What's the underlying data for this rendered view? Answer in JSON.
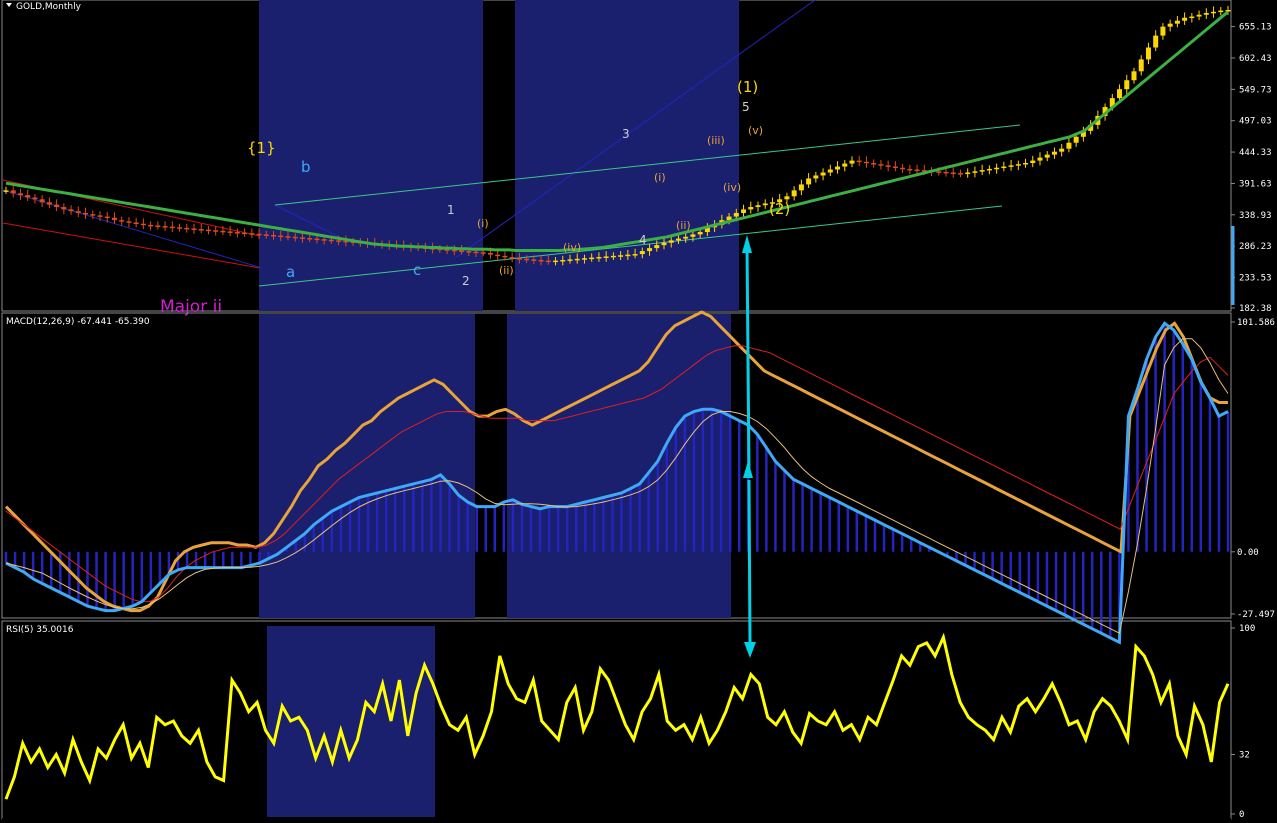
{
  "chart_data": [
    {
      "type": "candlestick",
      "title": "GOLD,Monthly",
      "ylim": [
        182.38,
        683.0
      ],
      "y_ticks": [
        "655.13",
        "602.43",
        "549.73",
        "497.03",
        "444.33",
        "391.63",
        "338.93",
        "286.23",
        "233.53",
        "182.38"
      ],
      "close_series": [
        380,
        375,
        372,
        368,
        365,
        360,
        356,
        352,
        348,
        345,
        342,
        340,
        338,
        336,
        334,
        330,
        328,
        326,
        324,
        322,
        321,
        320,
        319,
        318,
        317,
        316,
        315,
        314,
        313,
        312,
        311,
        310,
        309,
        308,
        307,
        306,
        305,
        304,
        303,
        302,
        301,
        300,
        299,
        298,
        297,
        296,
        295,
        294,
        293,
        292,
        291,
        290,
        289,
        288,
        287,
        286,
        285,
        284,
        283,
        282,
        281,
        280,
        279,
        278,
        277,
        276,
        275,
        272,
        270,
        268,
        266,
        265,
        264,
        263,
        262,
        261,
        262,
        263,
        264,
        265,
        266,
        267,
        268,
        269,
        270,
        271,
        272,
        273,
        278,
        283,
        288,
        292,
        296,
        299,
        302,
        306,
        310,
        318,
        322,
        330,
        336,
        342,
        348,
        352,
        355,
        358,
        360,
        365,
        370,
        380,
        390,
        400,
        405,
        410,
        415,
        420,
        425,
        430,
        428,
        426,
        424,
        422,
        420,
        418,
        416,
        415,
        414,
        413,
        412,
        411,
        410,
        409,
        408,
        410,
        412,
        414,
        416,
        418,
        420,
        422,
        424,
        426,
        430,
        435,
        440,
        445,
        450,
        460,
        470,
        480,
        490,
        505,
        520,
        535,
        550,
        565,
        580,
        600,
        620,
        640,
        655,
        660,
        665,
        670,
        672,
        675,
        678,
        680,
        682,
        683
      ],
      "ma_series": [
        392,
        390,
        388,
        386,
        384,
        382,
        380,
        378,
        376,
        374,
        372,
        370,
        368,
        366,
        364,
        362,
        360,
        358,
        356,
        354,
        352,
        350,
        348,
        346,
        344,
        342,
        340,
        338,
        336,
        334,
        332,
        330,
        328,
        326,
        324,
        322,
        320,
        318,
        316,
        314,
        312,
        310,
        308,
        306,
        304,
        302,
        300,
        298,
        296,
        294,
        292,
        290,
        289,
        288,
        287,
        286,
        286,
        285,
        285,
        284,
        284,
        283,
        283,
        282,
        282,
        281,
        281,
        281,
        280,
        280,
        280,
        279,
        279,
        279,
        279,
        279,
        279,
        279,
        280,
        280,
        281,
        282,
        283,
        284,
        286,
        288,
        290,
        292,
        294,
        296,
        298,
        300,
        302,
        305,
        308,
        311,
        314,
        317,
        320,
        323,
        326,
        329,
        332,
        335,
        338,
        341,
        344,
        347,
        350,
        353,
        356,
        359,
        362,
        365,
        368,
        371,
        374,
        377,
        380,
        383,
        386,
        389,
        392,
        395,
        398,
        401,
        404,
        407,
        410,
        413,
        416,
        419,
        422,
        425,
        428,
        431,
        434,
        437,
        440,
        443,
        446,
        449,
        452,
        455,
        458,
        461,
        464,
        467,
        470,
        475,
        480,
        490,
        500,
        510,
        520,
        530,
        540,
        550,
        560,
        570,
        580,
        590,
        600,
        610,
        620,
        630,
        640,
        650,
        660,
        670,
        680
      ],
      "annotations": [
        "{1}",
        "b",
        "a",
        "c",
        "Major ii",
        "1",
        "2",
        "3",
        "4",
        "5",
        "(1)",
        "(2)",
        "(i)",
        "(ii)",
        "(iii)",
        "(iv)",
        "(v)"
      ]
    },
    {
      "type": "line",
      "title": "MACD(12,26,9) -67.441 -65.390",
      "ylim": [
        -27.497,
        101.586
      ],
      "y_ticks": [
        "101.586",
        "0.00",
        "-27.497"
      ],
      "series": [
        {
          "name": "MACD",
          "color": "#e8a33a",
          "values": [
            20,
            16,
            12,
            8,
            4,
            0,
            -4,
            -8,
            -12,
            -16,
            -19,
            -22,
            -24,
            -25,
            -26,
            -26,
            -24,
            -20,
            -12,
            -4,
            0,
            2,
            3,
            4,
            4,
            4,
            3,
            3,
            2,
            4,
            8,
            14,
            20,
            27,
            32,
            38,
            41,
            45,
            48,
            52,
            56,
            58,
            62,
            65,
            68,
            70,
            72,
            74,
            76,
            74,
            70,
            66,
            62,
            60,
            60,
            62,
            63,
            61,
            58,
            56,
            58,
            60,
            62,
            64,
            66,
            68,
            70,
            72,
            74,
            76,
            78,
            80,
            84,
            90,
            96,
            100,
            102,
            104,
            106,
            104,
            100,
            96,
            92,
            88,
            84,
            80,
            78,
            76,
            74,
            72,
            70,
            68,
            66,
            64,
            62,
            60,
            58,
            56,
            54,
            52,
            50,
            48,
            46,
            44,
            42,
            40,
            38,
            36,
            34,
            32,
            30,
            28,
            26,
            24,
            22,
            20,
            18,
            16,
            14,
            12,
            10,
            8,
            6,
            4,
            2,
            0,
            60,
            70,
            80,
            90,
            98,
            101,
            95,
            85,
            75,
            68,
            66,
            66
          ]
        },
        {
          "name": "Signal",
          "color": "#e02020",
          "values": [
            18,
            15,
            12,
            9,
            6,
            3,
            0,
            -3,
            -6,
            -9,
            -12,
            -15,
            -17,
            -19,
            -21,
            -22,
            -22,
            -20,
            -16,
            -11,
            -7,
            -4,
            -2,
            0,
            1,
            2,
            2,
            2,
            2,
            3,
            5,
            8,
            12,
            16,
            20,
            24,
            28,
            32,
            35,
            38,
            41,
            44,
            47,
            50,
            53,
            55,
            57,
            59,
            61,
            62,
            62,
            62,
            61,
            60,
            59,
            59,
            59,
            59,
            58,
            58,
            58,
            58,
            59,
            60,
            61,
            62,
            63,
            64,
            65,
            66,
            67,
            68,
            70,
            72,
            75,
            78,
            81,
            84,
            87,
            89,
            90,
            91,
            91,
            90,
            89,
            88,
            86,
            84,
            82,
            80,
            78,
            76,
            74,
            72,
            70,
            68,
            66,
            64,
            62,
            60,
            58,
            56,
            54,
            52,
            50,
            48,
            46,
            44,
            42,
            40,
            38,
            36,
            34,
            32,
            30,
            28,
            26,
            24,
            22,
            20,
            18,
            16,
            14,
            12,
            10,
            20,
            30,
            40,
            50,
            60,
            70,
            75,
            80,
            84,
            86,
            82,
            78
          ]
        },
        {
          "name": "Histogram",
          "color": "#2828d8",
          "values": [
            -5,
            -7,
            -9,
            -12,
            -14,
            -16,
            -18,
            -20,
            -22,
            -24,
            -25,
            -26,
            -26,
            -25,
            -24,
            -22,
            -18,
            -14,
            -10,
            -8,
            -7,
            -7,
            -7,
            -7,
            -7,
            -7,
            -7,
            -6,
            -5,
            -3,
            -1,
            2,
            5,
            8,
            12,
            15,
            18,
            20,
            22,
            24,
            25,
            26,
            27,
            28,
            29,
            30,
            31,
            32,
            34,
            30,
            25,
            22,
            20,
            20,
            20,
            22,
            23,
            21,
            20,
            19,
            20,
            20,
            20,
            21,
            22,
            23,
            24,
            25,
            26,
            28,
            30,
            35,
            40,
            48,
            55,
            60,
            62,
            63,
            63,
            62,
            60,
            58,
            56,
            52,
            46,
            40,
            36,
            32,
            30,
            28,
            26,
            24,
            22,
            20,
            18,
            16,
            14,
            12,
            10,
            8,
            6,
            4,
            2,
            0,
            -2,
            -4,
            -6,
            -8,
            -10,
            -12,
            -14,
            -16,
            -18,
            -20,
            -22,
            -24,
            -26,
            -28,
            -30,
            -32,
            -34,
            -36,
            -38,
            -40,
            60,
            72,
            85,
            95,
            101,
            98,
            92,
            85,
            75,
            68,
            60,
            62
          ]
        }
      ]
    },
    {
      "type": "line",
      "title": "RSI(5) 35.0016",
      "ylim": [
        0,
        100
      ],
      "y_ticks": [
        "100",
        "32",
        "0"
      ],
      "series": [
        {
          "name": "RSI",
          "color": "#ffff00",
          "values": [
            8,
            20,
            38,
            28,
            35,
            25,
            32,
            22,
            40,
            28,
            18,
            35,
            30,
            40,
            48,
            30,
            38,
            25,
            52,
            48,
            50,
            42,
            38,
            45,
            28,
            20,
            18,
            72,
            65,
            55,
            60,
            45,
            38,
            58,
            50,
            52,
            45,
            30,
            42,
            28,
            45,
            30,
            40,
            60,
            55,
            70,
            50,
            72,
            42,
            65,
            80,
            70,
            58,
            48,
            45,
            52,
            32,
            42,
            55,
            85,
            70,
            62,
            60,
            72,
            50,
            45,
            40,
            60,
            68,
            45,
            55,
            78,
            72,
            60,
            48,
            40,
            55,
            62,
            75,
            50,
            45,
            48,
            40,
            52,
            38,
            45,
            55,
            68,
            62,
            75,
            70,
            52,
            48,
            55,
            44,
            38,
            54,
            50,
            48,
            55,
            45,
            48,
            40,
            52,
            48,
            60,
            72,
            85,
            80,
            90,
            92,
            85,
            95,
            75,
            60,
            52,
            48,
            45,
            40,
            52,
            44,
            58,
            62,
            55,
            62,
            70,
            60,
            48,
            50,
            40,
            55,
            62,
            58,
            50,
            40,
            90,
            85,
            75,
            60,
            70,
            42,
            32,
            58,
            48,
            28,
            60,
            70
          ]
        }
      ]
    }
  ],
  "colors": {
    "background": "#000000",
    "panel_border": "#8a8a8a",
    "highlight": "#1a1f6e",
    "bull_candle": "#ffd700",
    "bear_candle": "#e04a1e",
    "ma_line": "#3cb043",
    "channel": "#3cc88a",
    "trend_blue": "#2424c0",
    "trend_red": "#d01010",
    "arrow": "#00d0e8",
    "rsi": "#ffff00",
    "macd": "#e8a33a",
    "signal": "#e02020",
    "macd_blue": "#3fa9f5",
    "label_text": "#cfcfcf"
  }
}
